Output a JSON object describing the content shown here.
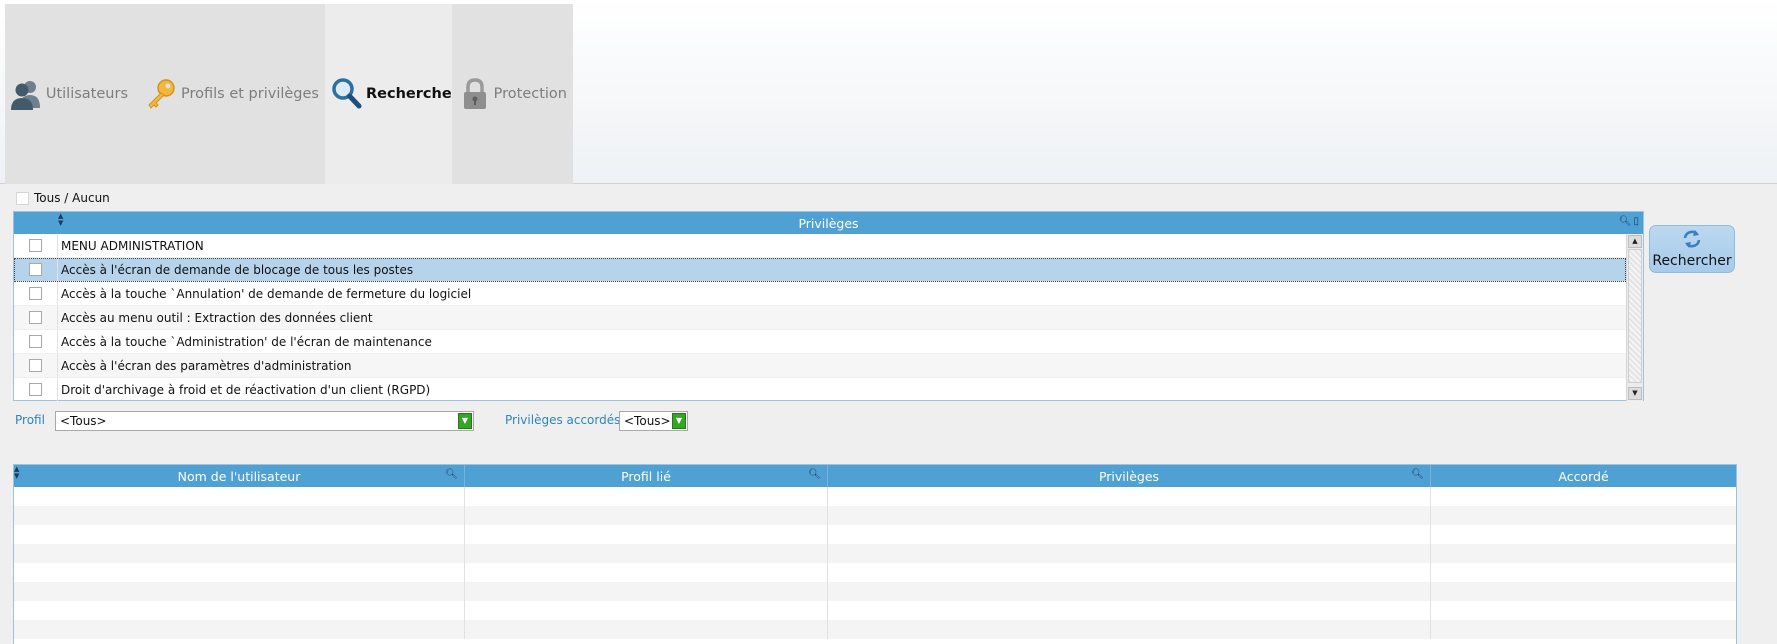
{
  "tabs": [
    {
      "label": "Utilisateurs",
      "icon": "users-icon"
    },
    {
      "label": "Profils et privilèges",
      "icon": "key-icon"
    },
    {
      "label": "Rechercher",
      "icon": "magnifier-icon",
      "active": true
    },
    {
      "label": "Protection",
      "icon": "lock-icon"
    }
  ],
  "toggle_all": {
    "label": "Tous / Aucun"
  },
  "privileges_grid": {
    "header": "Privilèges",
    "rows": [
      {
        "label": "MENU ADMINISTRATION",
        "checked": false
      },
      {
        "label": "Accès à l'écran de demande de blocage de tous les postes",
        "checked": false,
        "selected": true
      },
      {
        "label": "Accès à la touche `Annulation' de demande de fermeture du logiciel",
        "checked": false
      },
      {
        "label": "Accès au menu outil : Extraction des données client",
        "checked": false
      },
      {
        "label": "Accès à la touche `Administration' de l'écran de maintenance",
        "checked": false
      },
      {
        "label": "Accès à l'écran des paramètres d'administration",
        "checked": false
      },
      {
        "label": "Droit d'archivage à froid et de réactivation d'un client (RGPD)",
        "checked": false
      }
    ]
  },
  "refresh_button": {
    "label": "Rechercher",
    "icon": "refresh-icon"
  },
  "filters": {
    "profil_label": "Profil",
    "profil_value": "<Tous>",
    "granted_label": "Privilèges accordés",
    "granted_value": "<Tous>"
  },
  "results_grid": {
    "columns": [
      "Nom de l'utilisateur",
      "Profil lié",
      "Privilèges",
      "Accordé"
    ],
    "rows": []
  },
  "colors": {
    "grid_header": "#4fa1d3",
    "selected_row": "#b6d3ec",
    "dropdown_button": "#36a526",
    "label_blue": "#2f85b8",
    "refresh_button": "#a6cbea"
  }
}
